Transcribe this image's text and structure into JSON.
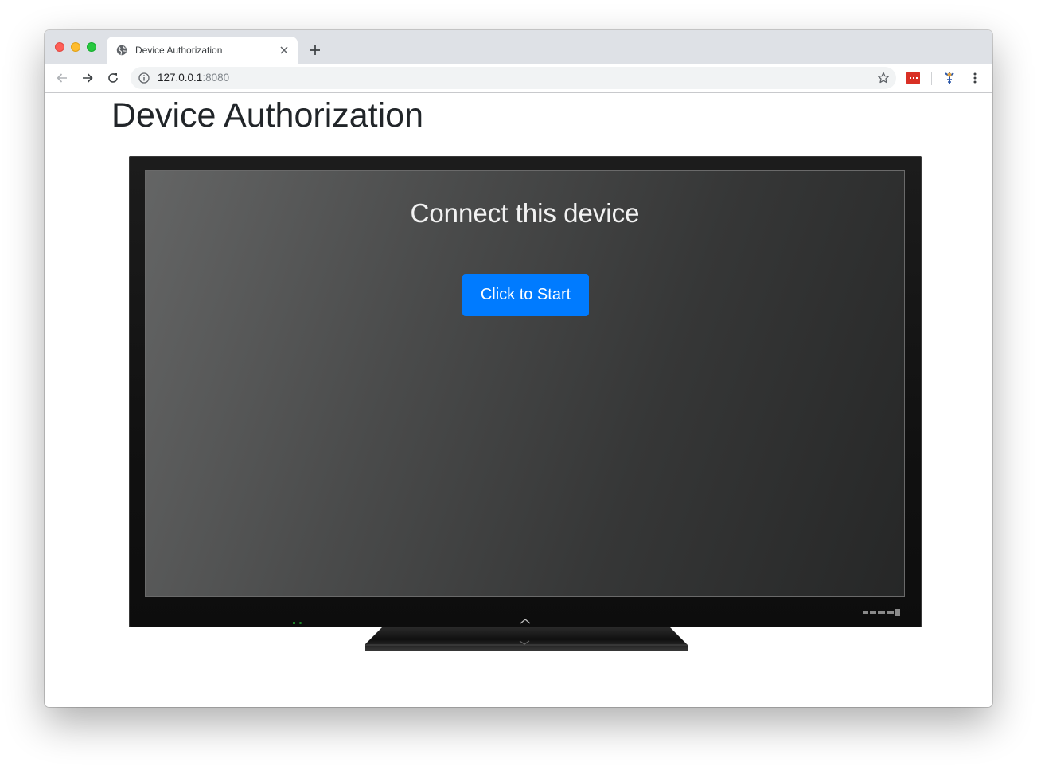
{
  "browser": {
    "tab_title": "Device Authorization",
    "url_host": "127.0.0.1",
    "url_port": ":8080"
  },
  "page": {
    "title": "Device Authorization",
    "screen_heading": "Connect this device",
    "start_button_label": "Click to Start"
  },
  "colors": {
    "button_primary": "#007bff",
    "title_text": "#212529"
  },
  "icons": [
    "globe-icon",
    "close-icon",
    "plus-icon",
    "back-icon",
    "forward-icon",
    "reload-icon",
    "info-icon",
    "star-icon",
    "extension-icon",
    "menu-icon"
  ]
}
